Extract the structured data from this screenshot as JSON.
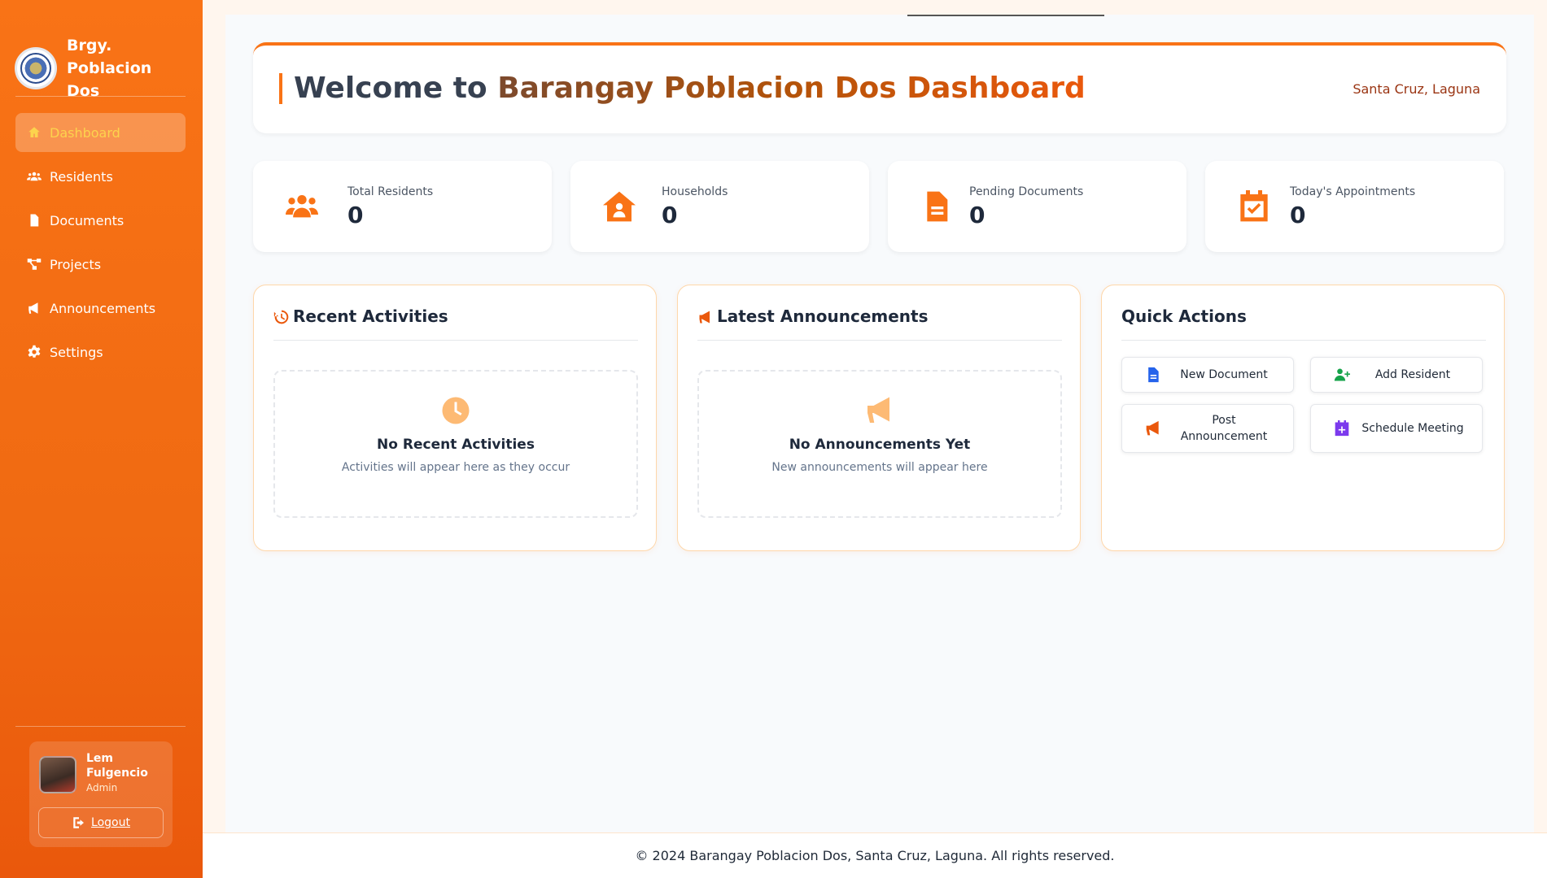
{
  "brand": {
    "name": "Brgy. Poblacion Dos"
  },
  "sidebar": {
    "items": [
      {
        "label": "Dashboard",
        "icon": "home-icon",
        "active": true
      },
      {
        "label": "Residents",
        "icon": "users-icon"
      },
      {
        "label": "Documents",
        "icon": "file-icon"
      },
      {
        "label": "Projects",
        "icon": "project-diagram-icon"
      },
      {
        "label": "Announcements",
        "icon": "bullhorn-icon"
      },
      {
        "label": "Settings",
        "icon": "gear-icon"
      }
    ]
  },
  "user": {
    "name": "Lem Fulgencio",
    "role": "Admin",
    "logout_label": "Logout"
  },
  "welcome": {
    "title_prefix": "Welcome to",
    "title_highlight": "Barangay Poblacion Dos Dashboard",
    "location": "Santa Cruz, Laguna"
  },
  "stats": [
    {
      "label": "Total Residents",
      "value": "0",
      "icon": "users-icon"
    },
    {
      "label": "Households",
      "value": "0",
      "icon": "house-user-icon"
    },
    {
      "label": "Pending Documents",
      "value": "0",
      "icon": "file-lines-icon"
    },
    {
      "label": "Today's Appointments",
      "value": "0",
      "icon": "calendar-check-icon"
    }
  ],
  "recent": {
    "title": "Recent Activities",
    "empty_title": "No Recent Activities",
    "empty_sub": "Activities will appear here as they occur"
  },
  "announcements": {
    "title": "Latest Announcements",
    "empty_title": "No Announcements Yet",
    "empty_sub": "New announcements will appear here"
  },
  "quick_actions": {
    "title": "Quick Actions",
    "items": [
      {
        "label": "New Document",
        "icon": "file-icon",
        "color": "#2563eb"
      },
      {
        "label": "Add Resident",
        "icon": "user-plus-icon",
        "color": "#16a34a"
      },
      {
        "label": "Post Announcement",
        "icon": "bullhorn-icon",
        "color": "#ea580c"
      },
      {
        "label": "Schedule Meeting",
        "icon": "calendar-plus-icon",
        "color": "#7c3aed"
      }
    ]
  },
  "footer": {
    "text": "© 2024 Barangay Poblacion Dos, Santa Cruz, Laguna. All rights reserved."
  },
  "colors": {
    "accent": "#f97316",
    "sidebar": "#f06a12"
  }
}
